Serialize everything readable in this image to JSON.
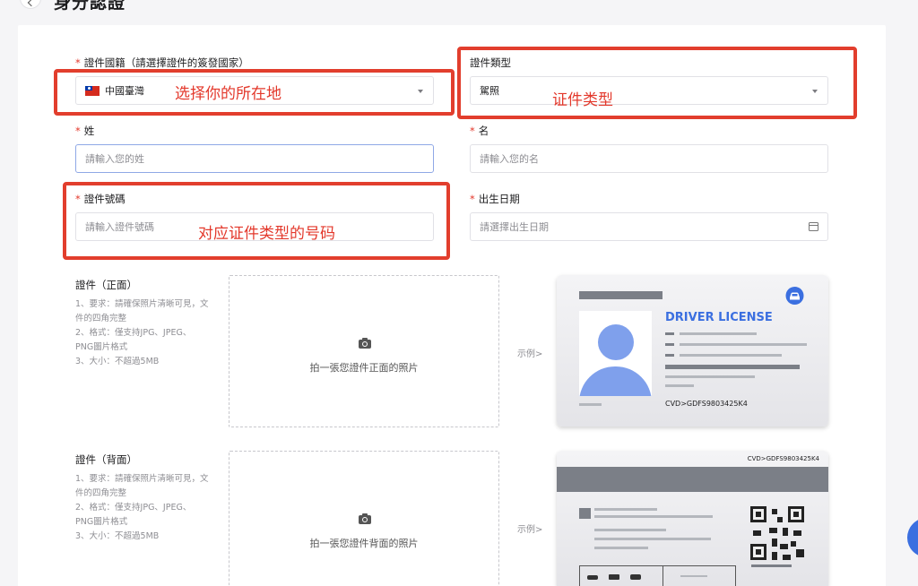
{
  "page": {
    "title": "身分認證"
  },
  "form": {
    "nationality": {
      "label": "證件國籍（請選擇證件的簽發國家）",
      "required_mark": "*",
      "value": "中國臺灣"
    },
    "doc_type": {
      "label": "證件類型",
      "value": "駕照"
    },
    "last_name": {
      "label": "姓",
      "required_mark": "*",
      "placeholder": "請輸入您的姓"
    },
    "first_name": {
      "label": "名",
      "required_mark": "*",
      "placeholder": "請輸入您的名"
    },
    "doc_number": {
      "label": "證件號碼",
      "required_mark": "*",
      "placeholder": "請輸入證件號碼"
    },
    "birthdate": {
      "label": "出生日期",
      "required_mark": "*",
      "placeholder": "請選擇出生日期"
    }
  },
  "annotations": {
    "location": "选择你的所在地",
    "doc_type": "证件类型",
    "doc_number": "对应证件类型的号码"
  },
  "uploads": [
    {
      "title": "證件（正面）",
      "hints": [
        "1、要求：請確保照片清晰可見，文",
        "件的四角完整",
        "2、格式：僅支持JPG、JPEG、",
        "PNG圖片格式",
        "3、大小：不超過5MB"
      ],
      "drop_text": "拍一張您證件正面的照片",
      "sample_label": "示例>"
    },
    {
      "title": "證件（背面）",
      "hints": [
        "1、要求：請確保照片清晰可見，文",
        "件的四角完整",
        "2、格式：僅支持JPG、JPEG、",
        "PNG圖片格式",
        "3、大小：不超過5MB"
      ],
      "drop_text": "拍一張您證件背面的照片",
      "sample_label": "示例>"
    }
  ],
  "samples": {
    "front": {
      "heading": "DRIVER LICENSE",
      "code": "CVD>GDFS9803425K4"
    },
    "back": {
      "code": "CVD>GDFS9803425K4"
    }
  },
  "colors": {
    "accent": "#3b6fe0",
    "annotation": "#e3382b",
    "required": "#e3382b"
  }
}
